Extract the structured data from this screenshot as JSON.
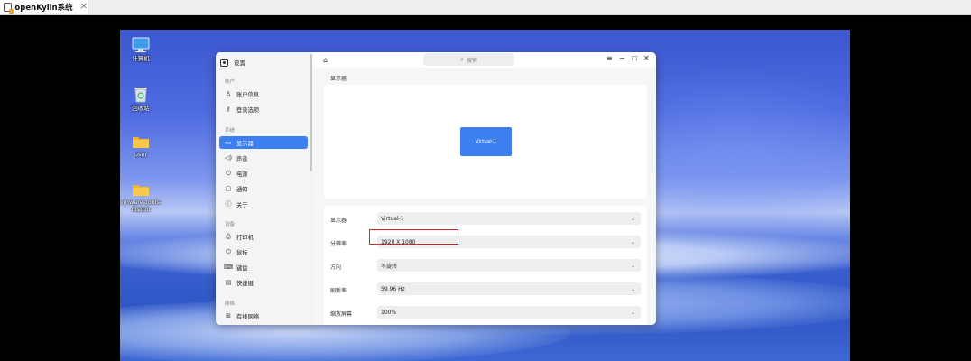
{
  "vm": {
    "tab_title": "openKylin系统",
    "close_glyph": "✕"
  },
  "desktop": {
    "icons": [
      {
        "label": "计算机",
        "icon": "computer-icon"
      },
      {
        "label": "回收站",
        "icon": "trash-icon"
      },
      {
        "label": "user",
        "icon": "folder-icon"
      },
      {
        "label": "vmware-tools-distrib",
        "icon": "folder-icon"
      }
    ]
  },
  "settings": {
    "app_title": "设置",
    "search_placeholder": "搜索",
    "sidebar": {
      "groups": [
        {
          "title": "账户",
          "items": [
            {
              "label": "账户信息",
              "icon": "user-icon",
              "glyph": "♙"
            },
            {
              "label": "登录选项",
              "icon": "key-icon",
              "glyph": "⚷"
            }
          ]
        },
        {
          "title": "系统",
          "items": [
            {
              "label": "显示器",
              "icon": "display-icon",
              "glyph": "▭",
              "active": true
            },
            {
              "label": "声音",
              "icon": "sound-icon",
              "glyph": "🔈"
            },
            {
              "label": "电源",
              "icon": "power-icon",
              "glyph": "⏻"
            },
            {
              "label": "通知",
              "icon": "notification-icon",
              "glyph": "▢"
            },
            {
              "label": "关于",
              "icon": "info-icon",
              "glyph": "ⓘ"
            }
          ]
        },
        {
          "title": "设备",
          "items": [
            {
              "label": "打印机",
              "icon": "printer-icon",
              "glyph": "⎙"
            },
            {
              "label": "鼠标",
              "icon": "mouse-icon",
              "glyph": "⌬"
            },
            {
              "label": "键盘",
              "icon": "keyboard-icon",
              "glyph": "⌨"
            },
            {
              "label": "快捷键",
              "icon": "shortcut-icon",
              "glyph": "▤"
            }
          ]
        },
        {
          "title": "网络",
          "items": [
            {
              "label": "有线网络",
              "icon": "wired-network-icon",
              "glyph": "⊞"
            }
          ]
        }
      ]
    },
    "display": {
      "section_title": "显示器",
      "monitor_label": "Virtual-1",
      "rows": [
        {
          "label": "显示器",
          "value": "Virtual-1"
        },
        {
          "label": "分辨率",
          "value": "1920 X 1080"
        },
        {
          "label": "方向",
          "value": "不旋转"
        },
        {
          "label": "刷新率",
          "value": "59.96 Hz"
        },
        {
          "label": "缩放屏幕",
          "value": "100%"
        }
      ]
    }
  }
}
